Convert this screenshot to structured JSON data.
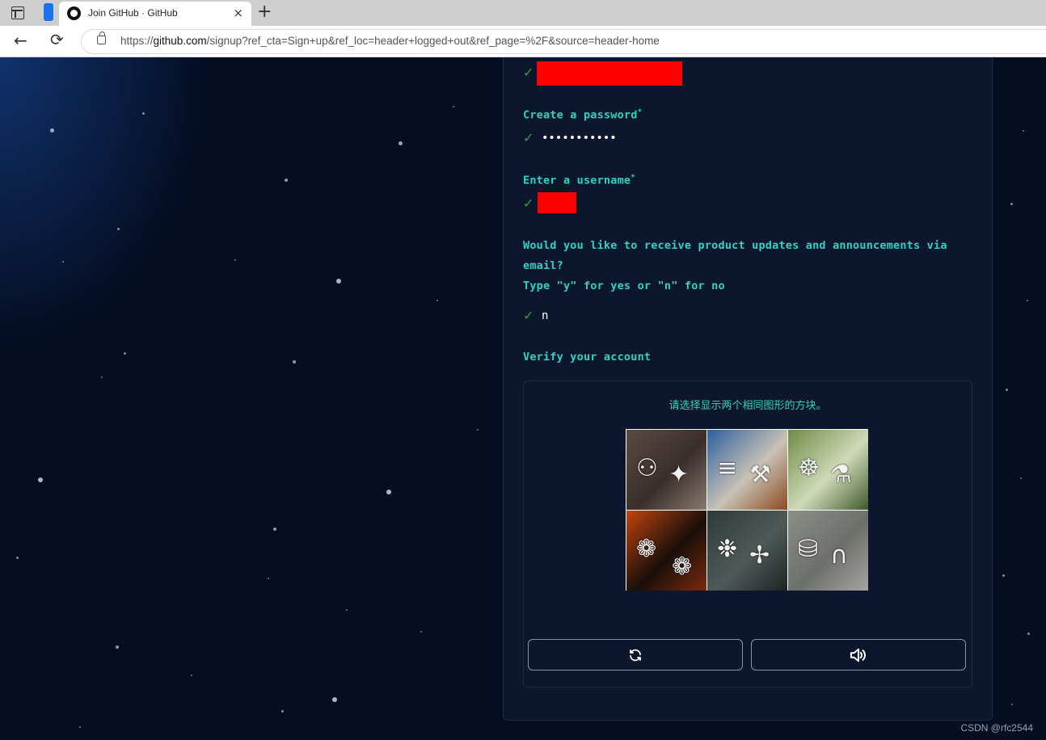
{
  "browser": {
    "tab_title": "Join GitHub · GitHub",
    "tab_close": "×",
    "new_tab": "+",
    "url_prefix": "https://",
    "url_host": "github.com",
    "url_path": "/signup?ref_cta=Sign+up&ref_loc=header+logged+out&ref_page=%2F&source=header-home"
  },
  "form": {
    "check_mark": "✓",
    "password_label": "Create a password",
    "password_value": "•••••••••••",
    "username_label": "Enter a username",
    "updates_label_line1": "Would you like to receive product updates and announcements via",
    "updates_label_line2": "email?",
    "updates_label_line3": "Type \"y\" for yes or \"n\" for no",
    "updates_value": "n",
    "verify_label": "Verify your account",
    "required_mark": "*"
  },
  "captcha": {
    "instruction": "请选择显示两个相同图形的方块。",
    "tiles": [
      {
        "icons": [
          "ghost-snail-icon",
          "satellite-icon"
        ],
        "bg": [
          "#5a4a44",
          "#3a2f2c",
          "#8a7a70"
        ]
      },
      {
        "icons": [
          "ladder-icon",
          "tools-icon"
        ],
        "bg": [
          "#2d5fa0",
          "#c9c2b5",
          "#8a4a20"
        ]
      },
      {
        "icons": [
          "bbq-grill-icon",
          "bottle-icon"
        ],
        "bg": [
          "#6f8a45",
          "#cfd9b8",
          "#3e5a2c"
        ]
      },
      {
        "icons": [
          "turtle-icon",
          "turtle-icon"
        ],
        "bg": [
          "#c1440e",
          "#1a0f0a",
          "#7a2a10"
        ]
      },
      {
        "icons": [
          "fish-icon",
          "propeller-icon"
        ],
        "bg": [
          "#2f3a3a",
          "#4f5a58",
          "#1e2424"
        ]
      },
      {
        "icons": [
          "backpack-icon",
          "magnet-icon"
        ],
        "bg": [
          "#8c8e88",
          "#6d6f6a",
          "#a4a59f"
        ]
      }
    ],
    "refresh_icon": "refresh-icon",
    "audio_icon": "speaker-icon"
  },
  "watermark": "CSDN @rfc2544",
  "colors": {
    "accent_teal": "#2ed3c1",
    "check_green": "#2ea043",
    "redaction": "#ff0000",
    "page_bg": "#040d21",
    "panel_bg": "#0c162d"
  }
}
